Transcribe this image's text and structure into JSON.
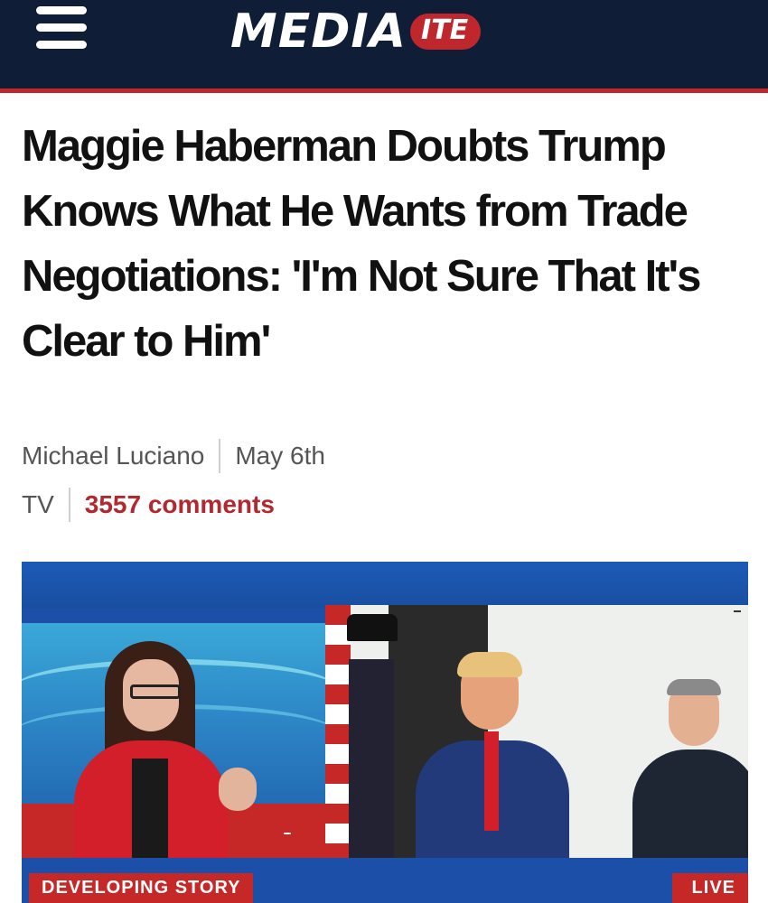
{
  "header": {
    "menu_icon": "hamburger-menu-icon",
    "logo_main": "MEDIA",
    "logo_badge": "ITE",
    "colors": {
      "background": "#0f1e36",
      "accent": "#c0272d"
    }
  },
  "article": {
    "headline": "Maggie Haberman Doubts Trump Knows What He Wants from Trade Negotiations: 'I'm Not Sure That It's Clear to Him'",
    "author": "Michael Luciano",
    "date": "May 6th",
    "category": "TV",
    "comments": "3557 comments",
    "comments_color": "#b3282f"
  },
  "video": {
    "lower_third_left": "DEVELOPING STORY",
    "lower_third_right": "LIVE",
    "badge_color": "#c62828"
  }
}
